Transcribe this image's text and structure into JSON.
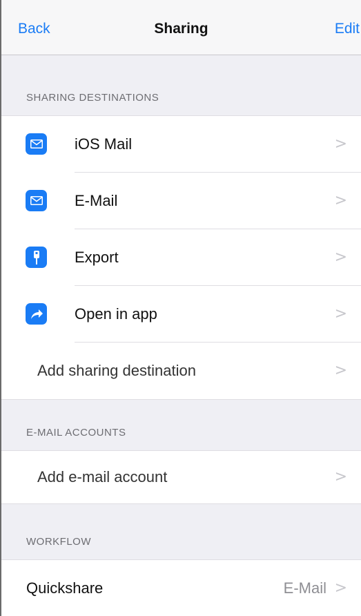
{
  "nav": {
    "back_label": "Back",
    "title": "Sharing",
    "edit_label": "Edit"
  },
  "sharing_destinations": {
    "header": "SHARING DESTINATIONS",
    "items": [
      {
        "label": "iOS Mail",
        "icon": "mail-icon"
      },
      {
        "label": "E-Mail",
        "icon": "mail-icon"
      },
      {
        "label": "Export",
        "icon": "usb-cable-icon"
      },
      {
        "label": "Open in app",
        "icon": "share-arrow-icon"
      }
    ],
    "add_label": "Add sharing destination"
  },
  "email_accounts": {
    "header": "E-MAIL ACCOUNTS",
    "add_label": "Add e-mail account"
  },
  "workflow": {
    "header": "WORKFLOW",
    "items": [
      {
        "label": "Quickshare",
        "value": "E-Mail"
      }
    ]
  },
  "colors": {
    "accent": "#1a7cf5",
    "background": "#efeff4",
    "chevron": "#c7c7cc"
  }
}
